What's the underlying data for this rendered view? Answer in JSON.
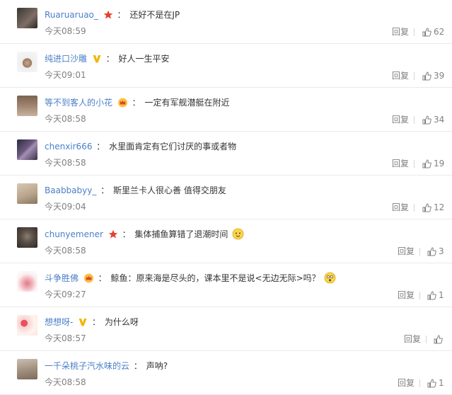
{
  "comments": [
    {
      "user": "Ruaruaruao_",
      "badge": "star",
      "text": "还好不是在JP",
      "time": "今天08:59",
      "reply": "回复",
      "likes": "62"
    },
    {
      "user": "纯进口沙雕",
      "badge": "v",
      "text": "好人一生平安",
      "time": "今天09:01",
      "reply": "回复",
      "likes": "39"
    },
    {
      "user": "等不到客人的小花",
      "badge": "crown",
      "text": "一定有军舰潜艇在附近",
      "time": "今天08:58",
      "reply": "回复",
      "likes": "34"
    },
    {
      "user": "chenxir666",
      "badge": "",
      "text": "水里面肯定有它们讨厌的事或者物",
      "time": "今天08:58",
      "reply": "回复",
      "likes": "19"
    },
    {
      "user": "Baabbabyy_",
      "badge": "",
      "text": "斯里兰卡人很心善 值得交朋友",
      "time": "今天09:04",
      "reply": "回复",
      "likes": "12"
    },
    {
      "user": "chunyemener",
      "badge": "star",
      "text": "集体捕鱼算错了退潮时间",
      "time": "今天08:58",
      "reply": "回复",
      "likes": "3",
      "emoji": "emoji-face"
    },
    {
      "user": "斗争胜佛",
      "badge": "crown",
      "text": "鲸鱼：原来海是尽头的，课本里不是说<无边无际>吗？",
      "time": "今天09:27",
      "reply": "回复",
      "likes": "1",
      "emoji": "emoji-surprise"
    },
    {
      "user": "想想呀-",
      "badge": "v",
      "text": "为什么呀",
      "time": "今天08:57",
      "reply": "回复",
      "likes": ""
    },
    {
      "user": "一千朵桃子汽水味的云",
      "badge": "",
      "text": "声呐?",
      "time": "今天08:58",
      "reply": "回复",
      "likes": "1"
    }
  ],
  "colors": {
    "username": "#4a7fc9",
    "text": "#333333",
    "meta": "#808080",
    "star": "#e8402d",
    "v": "#f4b400"
  },
  "separator": "："
}
